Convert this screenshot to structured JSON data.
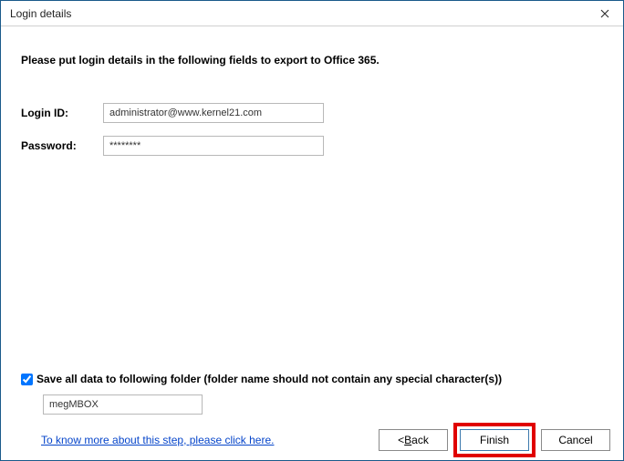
{
  "window": {
    "title": "Login details"
  },
  "instruction": "Please put login details in the following fields to export to Office 365.",
  "form": {
    "login_label": "Login ID:",
    "login_value": "administrator@www.kernel21.com",
    "password_label": "Password:",
    "password_value": "********"
  },
  "save_section": {
    "checkbox_checked": true,
    "checkbox_label": "Save all data to following folder (folder name should not contain any special character(s))",
    "folder_value": "megMBOX"
  },
  "footer": {
    "help_link": "To know more about this step, please click here.",
    "back_prefix": "< ",
    "back_key": "B",
    "back_rest": "ack",
    "finish_label": "Finish",
    "cancel_label": "Cancel"
  }
}
